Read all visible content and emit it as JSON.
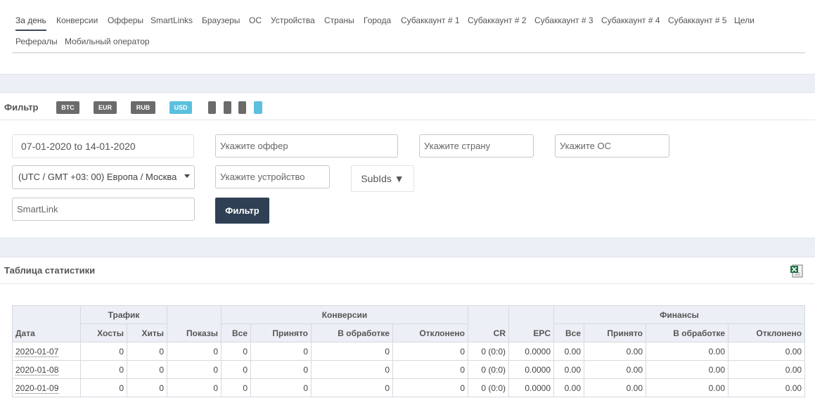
{
  "tabs": [
    {
      "label": "За день",
      "active": true
    },
    {
      "label": "Конверсии"
    },
    {
      "label": "Офферы"
    },
    {
      "label": "SmartLinks"
    },
    {
      "label": "Браузеры"
    },
    {
      "label": "ОС"
    },
    {
      "label": "Устройства"
    },
    {
      "label": "Страны"
    },
    {
      "label": "Города"
    },
    {
      "label": "Субаккаунт # 1"
    },
    {
      "label": "Субаккаунт # 2"
    },
    {
      "label": "Субаккаунт # 3"
    },
    {
      "label": "Субаккаунт # 4"
    },
    {
      "label": "Субаккаунт # 5"
    },
    {
      "label": "Цели"
    },
    {
      "label": "Рефералы"
    },
    {
      "label": "Мобильный оператор"
    }
  ],
  "filter": {
    "title": "Фильтр",
    "currencies": [
      "BTC",
      "EUR",
      "RUB",
      "USD"
    ],
    "active_currency": "USD",
    "date_range": "07-01-2020 to 14-01-2020",
    "offer_placeholder": "Укажите оффер",
    "country_placeholder": "Укажите страну",
    "os_placeholder": "Укажите ОС",
    "timezone": "(UTC / GMT +03: 00) Европа / Москва",
    "device_placeholder": "Укажите устройство",
    "subids_label": "SubIds ▼",
    "smartlink_placeholder": "SmartLink",
    "filter_button": "Фильтр"
  },
  "stats": {
    "title": "Таблица статистики",
    "export_icon": "excel-icon",
    "groups": {
      "traffic": "Трафик",
      "conversions": "Конверсии",
      "finance": "Финансы"
    },
    "columns": {
      "date": "Дата",
      "hosts": "Хосты",
      "hits": "Хиты",
      "impressions": "Показы",
      "conv_all": "Все",
      "conv_accepted": "Принято",
      "conv_pending": "В обработке",
      "conv_rejected": "Отклонено",
      "cr": "CR",
      "epc": "EPC",
      "fin_all": "Все",
      "fin_accepted": "Принято",
      "fin_pending": "В обработке",
      "fin_rejected": "Отклонено"
    },
    "rows": [
      [
        "2020-01-07",
        "0",
        "0",
        "0",
        "0",
        "0",
        "0",
        "0",
        "0 (0:0)",
        "0.0000",
        "0.00",
        "0.00",
        "0.00",
        "0.00"
      ],
      [
        "2020-01-08",
        "0",
        "0",
        "0",
        "0",
        "0",
        "0",
        "0",
        "0 (0:0)",
        "0.0000",
        "0.00",
        "0.00",
        "0.00",
        "0.00"
      ],
      [
        "2020-01-09",
        "0",
        "0",
        "0",
        "0",
        "0",
        "0",
        "0",
        "0 (0:0)",
        "0.0000",
        "0.00",
        "0.00",
        "0.00",
        "0.00"
      ]
    ]
  }
}
